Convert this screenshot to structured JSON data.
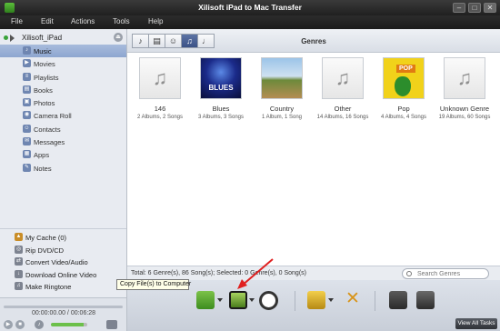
{
  "window": {
    "title": "Xilisoft iPad to Mac Transfer",
    "buttons": [
      "–",
      "□",
      "✕"
    ]
  },
  "menu": {
    "items": [
      "File",
      "Edit",
      "Actions",
      "Tools",
      "Help"
    ]
  },
  "device": {
    "name": "Xilisoft_iPad"
  },
  "sidebar": {
    "items": [
      {
        "label": "Music",
        "icon": "music-icon"
      },
      {
        "label": "Movies",
        "icon": "film-icon"
      },
      {
        "label": "Playlists",
        "icon": "playlist-icon"
      },
      {
        "label": "Books",
        "icon": "book-icon"
      },
      {
        "label": "Photos",
        "icon": "photo-icon"
      },
      {
        "label": "Camera Roll",
        "icon": "camera-icon"
      },
      {
        "label": "Contacts",
        "icon": "contact-icon"
      },
      {
        "label": "Messages",
        "icon": "message-icon"
      },
      {
        "label": "Apps",
        "icon": "apps-icon"
      },
      {
        "label": "Notes",
        "icon": "notes-icon"
      }
    ],
    "active_index": 0,
    "tools": [
      {
        "label": "My Cache (0)",
        "icon": "cache-icon"
      },
      {
        "label": "Rip DVD/CD",
        "icon": "disc-icon"
      },
      {
        "label": "Convert Video/Audio",
        "icon": "convert-icon"
      },
      {
        "label": "Download Online Video",
        "icon": "download-icon"
      },
      {
        "label": "Make Ringtone",
        "icon": "ringtone-icon"
      }
    ]
  },
  "player": {
    "time": "00:00:00.00 / 00:06:28",
    "volume": 0.9
  },
  "main": {
    "section_title": "Genres",
    "genres": [
      {
        "name": "146",
        "count": "2 Albums, 2 Songs",
        "art": "plain"
      },
      {
        "name": "Blues",
        "count": "3 Albums, 3 Songs",
        "art": "blues",
        "art_text": "BLUES"
      },
      {
        "name": "Country",
        "count": "1 Album, 1 Song",
        "art": "country"
      },
      {
        "name": "Other",
        "count": "14 Albums, 16 Songs",
        "art": "plain"
      },
      {
        "name": "Pop",
        "count": "4 Albums, 4 Songs",
        "art": "pop",
        "art_text": "POP"
      },
      {
        "name": "Unknown Genre",
        "count": "19 Albums, 60 Songs",
        "art": "plain"
      }
    ],
    "status": "Total: 6 Genre(s), 86 Song(s); Selected: 0 Genre(s), 0 Song(s)",
    "search_placeholder": "Search Genres"
  },
  "toolbar": {
    "tooltip": "Copy File(s) to Computer"
  },
  "view_all_tasks": "View All Tasks",
  "colors": {
    "accent": "#3b5286",
    "annotation_arrow": "#e02020"
  }
}
